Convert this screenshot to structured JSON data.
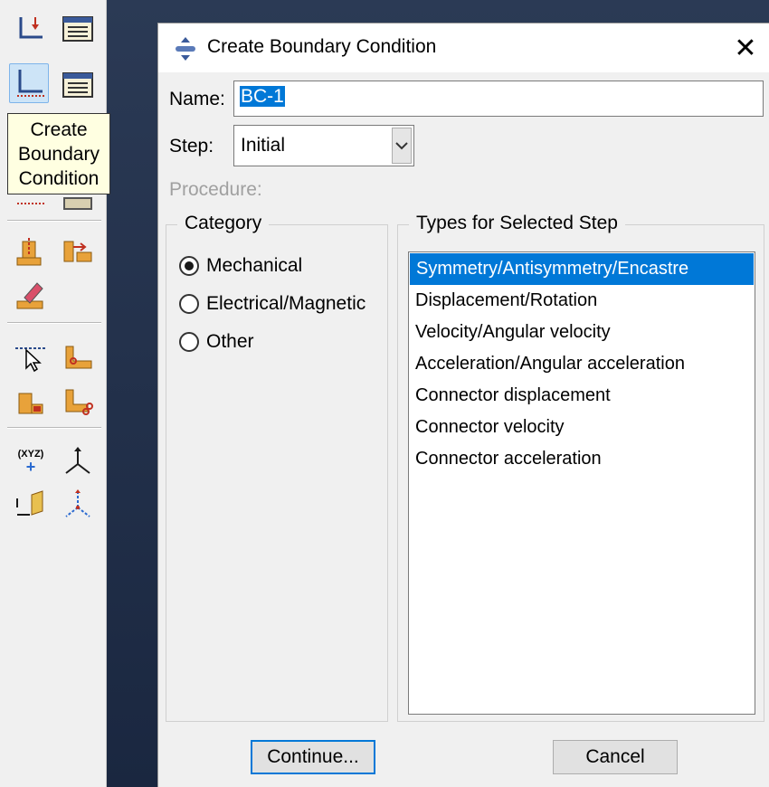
{
  "tooltip": {
    "text": "Create\nBoundary\nCondition"
  },
  "dialog": {
    "title": "Create Boundary Condition",
    "close_glyph": "✕",
    "name_label": "Name:",
    "name_value": "BC-1",
    "step_label": "Step:",
    "step_value": "Initial",
    "procedure_label": "Procedure:",
    "category": {
      "title": "Category",
      "options": [
        {
          "label": "Mechanical",
          "selected": true
        },
        {
          "label": "Electrical/Magnetic",
          "selected": false
        },
        {
          "label": "Other",
          "selected": false
        }
      ]
    },
    "types": {
      "title": "Types for Selected Step",
      "items": [
        "Symmetry/Antisymmetry/Encastre",
        "Displacement/Rotation",
        "Velocity/Angular velocity",
        "Acceleration/Angular acceleration",
        "Connector displacement",
        "Connector velocity",
        "Connector acceleration"
      ],
      "selected_index": 0
    },
    "continue_label": "Continue...",
    "cancel_label": "Cancel"
  },
  "toolbox": {
    "icons": [
      "boundary-condition-icon",
      "bc-manager-icon",
      "create-boundary-condition-icon",
      "bc-manager-icon",
      "load-icon",
      "load-manager-icon",
      "predefined-field-icon",
      "field-manager-icon",
      "eraser-icon",
      "point-select-icon",
      "partition-icon",
      "block-icon",
      "cut-icon",
      "xyz-datum-icon",
      "csys-icon",
      "plane-icon",
      "axis-icon"
    ],
    "datum_label": "(XYZ)"
  }
}
